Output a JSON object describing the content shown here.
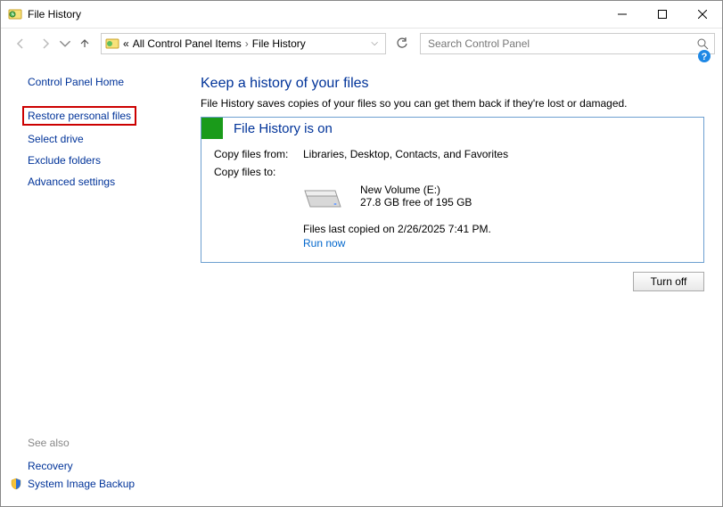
{
  "window": {
    "title": "File History"
  },
  "breadcrumb": {
    "prefix": "«",
    "item1": "All Control Panel Items",
    "item2": "File History"
  },
  "search": {
    "placeholder": "Search Control Panel"
  },
  "sidebar": {
    "home": "Control Panel Home",
    "links": {
      "restore": "Restore personal files",
      "select_drive": "Select drive",
      "exclude_folders": "Exclude folders",
      "advanced": "Advanced settings"
    },
    "see_also_label": "See also",
    "see_also": {
      "recovery": "Recovery",
      "system_image_backup": "System Image Backup"
    }
  },
  "main": {
    "title": "Keep a history of your files",
    "desc": "File History saves copies of your files so you can get them back if they're lost or damaged.",
    "status": "File History is on",
    "copy_from_label": "Copy files from:",
    "copy_from_value": "Libraries, Desktop, Contacts, and Favorites",
    "copy_to_label": "Copy files to:",
    "drive_name": "New Volume (E:)",
    "drive_free": "27.8 GB free of 195 GB",
    "last_copied": "Files last copied on 2/26/2025 7:41 PM.",
    "run_now": "Run now",
    "turn_off": "Turn off"
  }
}
